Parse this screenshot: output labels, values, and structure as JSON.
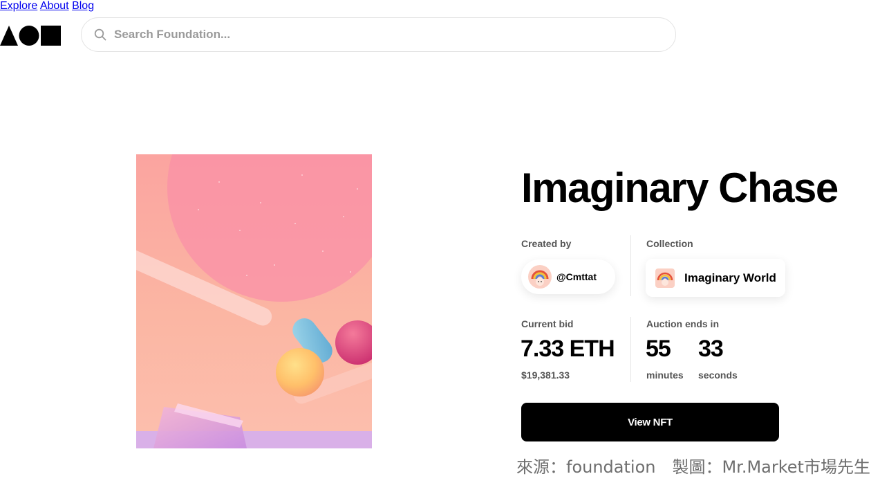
{
  "header": {
    "search_placeholder": "Search Foundation...",
    "nav": [
      {
        "label": "Explore"
      },
      {
        "label": "About"
      },
      {
        "label": "Blog"
      }
    ]
  },
  "nft": {
    "title": "Imaginary Chase",
    "created_by_label": "Created by",
    "creator_handle": "@Cmttat",
    "collection_label": "Collection",
    "collection_name": "Imaginary World",
    "current_bid_label": "Current bid",
    "current_bid": "7.33 ETH",
    "current_bid_usd": "$19,381.33",
    "auction_label": "Auction ends in",
    "minutes_value": "55",
    "minutes_label": "minutes",
    "seconds_value": "33",
    "seconds_label": "seconds",
    "view_button": "View NFT"
  },
  "watermark": "來源：foundation　製圖：Mr.Market市場先生",
  "colors": {
    "primary_button": "#000000",
    "artwork_background": "#f9b3a2",
    "text_muted": "#555555"
  },
  "icons": [
    "logo-shapes-icon",
    "search-icon"
  ]
}
